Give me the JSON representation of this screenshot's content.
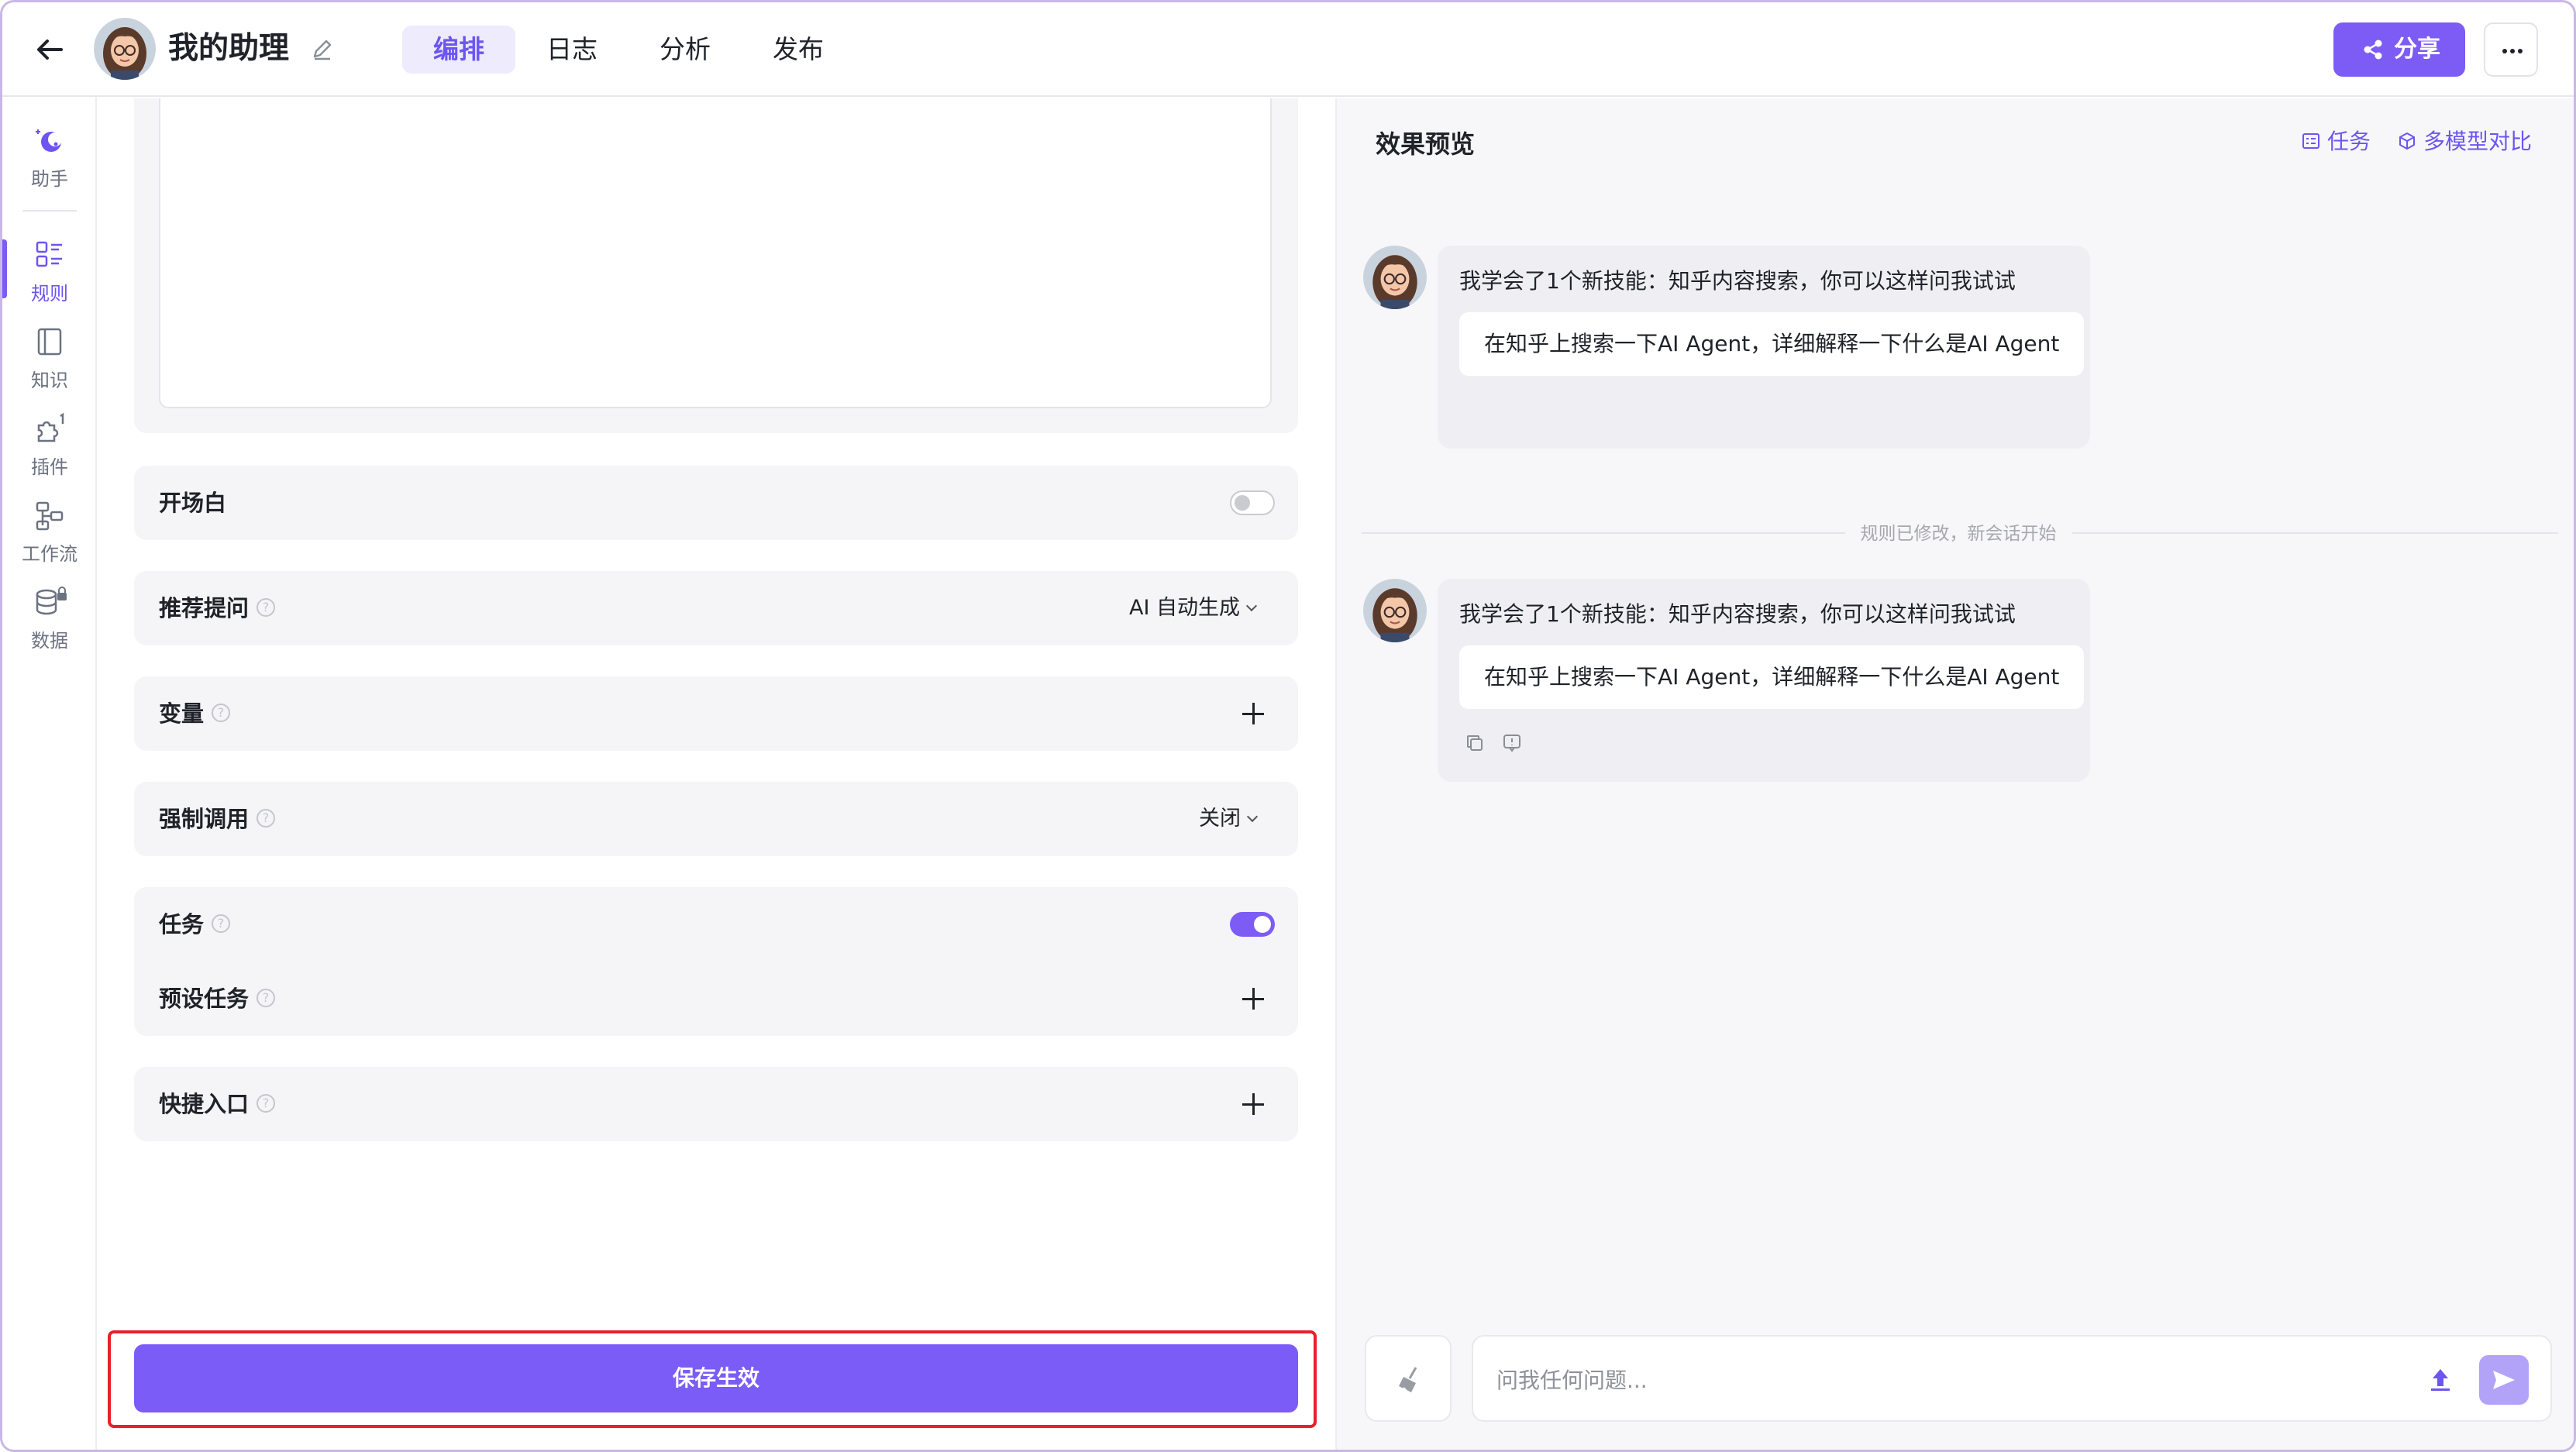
{
  "header": {
    "app_name": "我的助理",
    "tabs": [
      {
        "label": "编排",
        "active": true
      },
      {
        "label": "日志",
        "active": false
      },
      {
        "label": "分析",
        "active": false
      },
      {
        "label": "发布",
        "active": false
      }
    ],
    "share_label": "分享"
  },
  "rail": {
    "items": [
      {
        "label": "助手",
        "icon": "assistant-icon"
      },
      {
        "label": "规则",
        "icon": "rules-icon",
        "active": true
      },
      {
        "label": "知识",
        "icon": "knowledge-icon"
      },
      {
        "label": "插件",
        "icon": "plugin-icon",
        "badge": "1"
      },
      {
        "label": "工作流",
        "icon": "workflow-icon"
      },
      {
        "label": "数据",
        "icon": "database-icon",
        "locked": true
      }
    ]
  },
  "editor": {
    "opening": {
      "label": "开场白",
      "enabled": false
    },
    "suggested_questions": {
      "label": "推荐提问",
      "value": "AI 自动生成"
    },
    "variables": {
      "label": "变量"
    },
    "forced_call": {
      "label": "强制调用",
      "value": "关闭"
    },
    "tasks": {
      "label": "任务",
      "enabled": true
    },
    "preset_tasks": {
      "label": "预设任务"
    },
    "shortcuts": {
      "label": "快捷入口"
    },
    "save_label": "保存生效"
  },
  "preview": {
    "title": "效果预览",
    "task_label": "任务",
    "compare_label": "多模型对比",
    "messages": [
      {
        "text": "我学会了1个新技能：知乎内容搜索，你可以这样问我试试",
        "suggestion": "在知乎上搜索一下AI Agent，详细解释一下什么是AI Agent"
      },
      {
        "text": "我学会了1个新技能：知乎内容搜索，你可以这样问我试试",
        "suggestion": "在知乎上搜索一下AI Agent，详细解释一下什么是AI Agent"
      }
    ],
    "divider_text": "规则已修改，新会话开始",
    "input_placeholder": "问我任何问题..."
  },
  "colors": {
    "accent": "#7d5cf5",
    "accent_light": "#eeebfc",
    "highlight_border": "#e8202a"
  }
}
